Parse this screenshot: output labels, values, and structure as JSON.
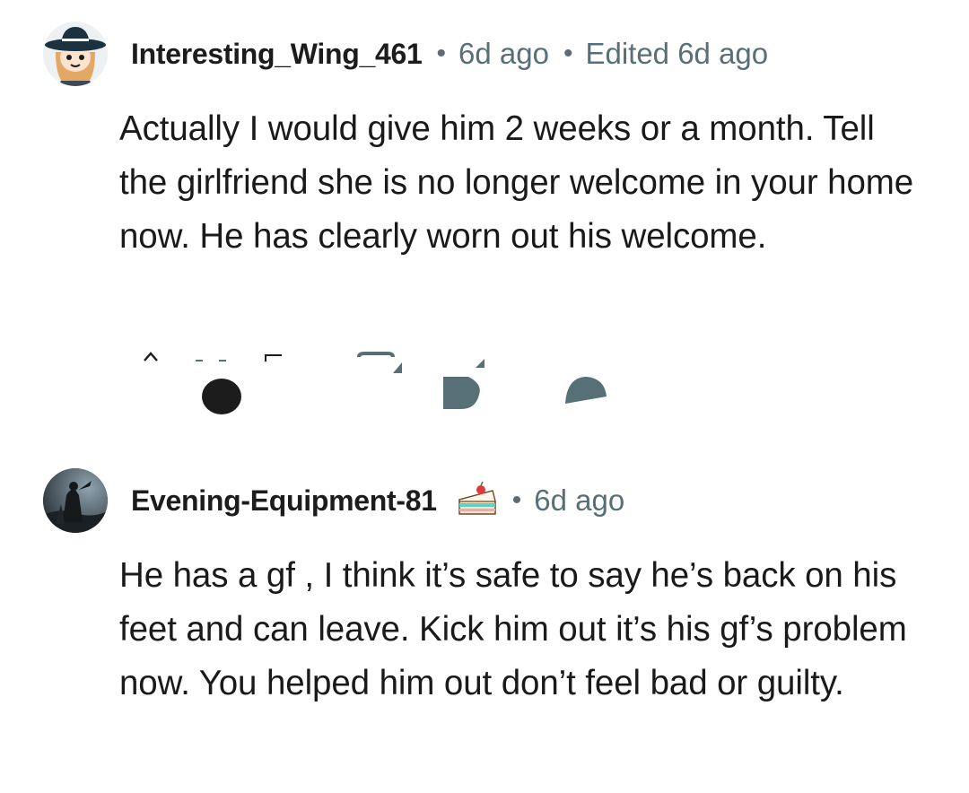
{
  "comments": [
    {
      "username": "Interesting_Wing_461",
      "separator": "•",
      "time": "6d ago",
      "edited": "Edited 6d ago",
      "avatar_icon": "cowboy-hat-avatar-icon",
      "body": "Actually I would give him 2 weeks or a month. Tell the girlfriend she is no longer welcome in your home now. He has clearly worn out his welcome.",
      "actions": [
        "upvote-icon",
        "vote-count",
        "reply-icon",
        "award-icon",
        "share-icon"
      ]
    },
    {
      "username": "Evening-Equipment-81",
      "flair_icon": "cake-slice-icon",
      "separator": "•",
      "time": "6d ago",
      "avatar_icon": "dark-knight-avatar-icon",
      "body": "He has a gf , I think it’s safe to say he’s back on his feet and can leave. Kick him out it’s his gf’s problem now. You helped him out don’t feel bad or guilty."
    }
  ],
  "colors": {
    "username": "#1c1c1c",
    "meta_gray": "#576f76",
    "body_text": "#1a1a1b",
    "action_icons": "#576f76"
  }
}
